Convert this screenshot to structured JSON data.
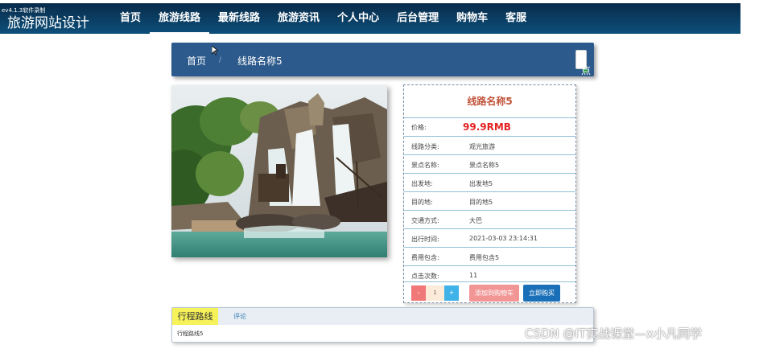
{
  "recorder_tag": "ev4.1.3软件录制",
  "site_title": "旅游网站设计",
  "nav": [
    {
      "label": "首页",
      "active": false
    },
    {
      "label": "旅游线路",
      "active": true
    },
    {
      "label": "最新线路",
      "active": false
    },
    {
      "label": "旅游资讯",
      "active": false
    },
    {
      "label": "个人中心",
      "active": false
    },
    {
      "label": "后台管理",
      "active": false
    },
    {
      "label": "购物车",
      "active": false
    },
    {
      "label": "客服",
      "active": false
    }
  ],
  "breadcrumb": {
    "home": "首页",
    "separator": "/",
    "current": "线路名称5"
  },
  "favorite_button": "点我收藏",
  "details": {
    "title": "线路名称5",
    "price_label": "价格:",
    "price": "99.9RMB",
    "rows": [
      {
        "label": "线路分类:",
        "value": "观光旅游"
      },
      {
        "label": "景点名称:",
        "value": "景点名称5"
      },
      {
        "label": "出发地:",
        "value": "出发地5"
      },
      {
        "label": "目的地:",
        "value": "目的地5"
      },
      {
        "label": "交通方式:",
        "value": "大巴"
      },
      {
        "label": "出行时间:",
        "value": "2021-03-03 23:14:31"
      },
      {
        "label": "费用包含:",
        "value": "费用包含5"
      },
      {
        "label": "点击次数:",
        "value": "11"
      }
    ]
  },
  "quantity": {
    "minus": "-",
    "value": "1",
    "plus": "+"
  },
  "add_to_cart": "添加到购物车",
  "buy_now": "立即购买",
  "tabs": [
    {
      "label": "行程路线",
      "active": true
    },
    {
      "label": "评论",
      "active": false
    }
  ],
  "tab_content": "行程路线5",
  "watermark": "CSDN @IT实战课堂—x小凡同学",
  "colors": {
    "nav_bg": "#0d4f7a",
    "breadcrumb_bg": "#2c5a8c",
    "price": "#e32222",
    "title": "#c0533a",
    "cart": "#f29595",
    "buy": "#1a70b8"
  }
}
